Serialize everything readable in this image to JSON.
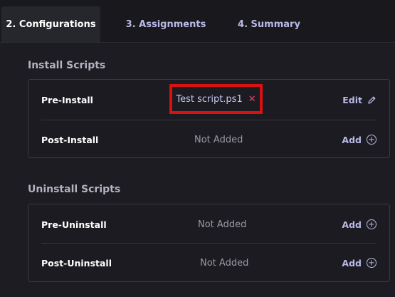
{
  "tabs": [
    {
      "label": "2. Configurations",
      "active": true
    },
    {
      "label": "3. Assignments",
      "active": false
    },
    {
      "label": "4. Summary",
      "active": false
    }
  ],
  "install": {
    "title": "Install Scripts",
    "rows": [
      {
        "label": "Pre-Install",
        "script": "Test script.ps1",
        "action": "Edit",
        "action_icon": "pencil-icon"
      },
      {
        "label": "Post-Install",
        "value": "Not Added",
        "action": "Add",
        "action_icon": "plus-circle-icon"
      }
    ]
  },
  "uninstall": {
    "title": "Uninstall Scripts",
    "rows": [
      {
        "label": "Pre-Uninstall",
        "value": "Not Added",
        "action": "Add",
        "action_icon": "plus-circle-icon"
      },
      {
        "label": "Post-Uninstall",
        "value": "Not Added",
        "action": "Add",
        "action_icon": "plus-circle-icon"
      }
    ]
  },
  "colors": {
    "accent": "#b9b9e6",
    "highlight_border": "#d81111",
    "remove": "#e0456e"
  }
}
